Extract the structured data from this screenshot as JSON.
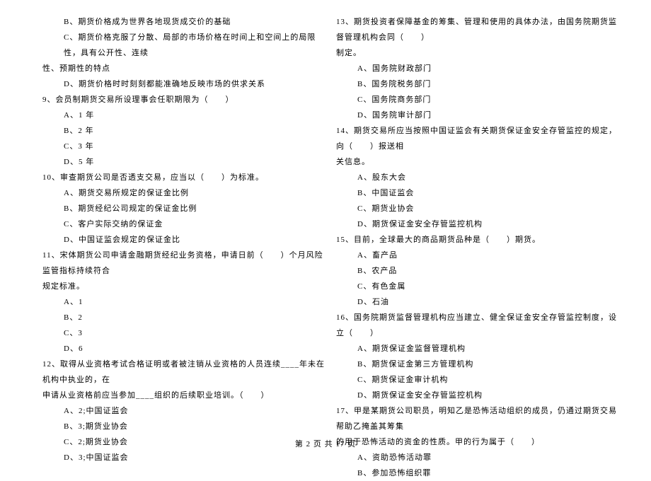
{
  "left_column": {
    "lines": [
      {
        "type": "option",
        "text": "B、期货价格成为世界各地现货成交价的基础"
      },
      {
        "type": "option",
        "text": "C、期货价格克服了分散、局部的市场价格在时间上和空间上的局限性，具有公开性、连续"
      },
      {
        "type": "continuation",
        "text": "性、预期性的特点"
      },
      {
        "type": "option",
        "text": "D、期货价格时时刻刻都能准确地反映市场的供求关系"
      },
      {
        "type": "question",
        "text": "9、会员制期货交易所设理事会任职期限为（　　）"
      },
      {
        "type": "option",
        "text": "A、1 年"
      },
      {
        "type": "option",
        "text": "B、2 年"
      },
      {
        "type": "option",
        "text": "C、3 年"
      },
      {
        "type": "option",
        "text": "D、5 年"
      },
      {
        "type": "question",
        "text": "10、审查期货公司是否透支交易，应当以（　　）为标准。"
      },
      {
        "type": "option",
        "text": "A、期货交易所规定的保证金比例"
      },
      {
        "type": "option",
        "text": "B、期货经纪公司规定的保证金比例"
      },
      {
        "type": "option",
        "text": "C、客户实际交纳的保证金"
      },
      {
        "type": "option",
        "text": "D、中国证监会规定的保证金比"
      },
      {
        "type": "question",
        "text": "11、宋体期货公司申请金融期货经纪业务资格，申请日前（　　）个月风险监管指标持续符合"
      },
      {
        "type": "continuation",
        "text": "规定标准。"
      },
      {
        "type": "option",
        "text": "A、1"
      },
      {
        "type": "option",
        "text": "B、2"
      },
      {
        "type": "option",
        "text": "C、3"
      },
      {
        "type": "option",
        "text": "D、6"
      },
      {
        "type": "question",
        "text": "12、取得从业资格考试合格证明或者被注销从业资格的人员连续____年未在机构中执业的，在"
      },
      {
        "type": "continuation",
        "text": "申请从业资格前应当参加____组织的后续职业培训。（　　）"
      },
      {
        "type": "option",
        "text": "A、2;中国证监会"
      },
      {
        "type": "option",
        "text": "B、3;期货业协会"
      },
      {
        "type": "option",
        "text": "C、2;期货业协会"
      },
      {
        "type": "option",
        "text": "D、3;中国证监会"
      }
    ]
  },
  "right_column": {
    "lines": [
      {
        "type": "question",
        "text": "13、期货投资者保障基金的筹集、管理和使用的具体办法，由国务院期货监督管理机构会同（　　）"
      },
      {
        "type": "continuation",
        "text": "制定。"
      },
      {
        "type": "option",
        "text": "A、国务院财政部门"
      },
      {
        "type": "option",
        "text": "B、国务院税务部门"
      },
      {
        "type": "option",
        "text": "C、国务院商务部门"
      },
      {
        "type": "option",
        "text": "D、国务院审计部门"
      },
      {
        "type": "question",
        "text": "14、期货交易所应当按照中国证监会有关期货保证金安全存管监控的规定，向（　　）报送相"
      },
      {
        "type": "continuation",
        "text": "关信息。"
      },
      {
        "type": "option",
        "text": "A、股东大会"
      },
      {
        "type": "option",
        "text": "B、中国证监会"
      },
      {
        "type": "option",
        "text": "C、期货业协会"
      },
      {
        "type": "option",
        "text": "D、期货保证金安全存管监控机构"
      },
      {
        "type": "question",
        "text": "15、目前，全球最大的商品期货品种是（　　）期货。"
      },
      {
        "type": "option",
        "text": "A、畜产品"
      },
      {
        "type": "option",
        "text": "B、农产品"
      },
      {
        "type": "option",
        "text": "C、有色金属"
      },
      {
        "type": "option",
        "text": "D、石油"
      },
      {
        "type": "question",
        "text": "16、国务院期货监督管理机构应当建立、健全保证金安全存管监控制度，设立（　　）"
      },
      {
        "type": "option",
        "text": "A、期货保证金监督管理机构"
      },
      {
        "type": "option",
        "text": "B、期货保证金第三方管理机构"
      },
      {
        "type": "option",
        "text": "C、期货保证金审计机构"
      },
      {
        "type": "option",
        "text": "D、期货保证金安全存管监控机构"
      },
      {
        "type": "question",
        "text": "17、甲是某期货公司职员，明知乙是恐怖活动组织的成员，仍通过期货交易帮助乙掩盖其筹集"
      },
      {
        "type": "continuation",
        "text": "的用于恐怖活动的资金的性质。甲的行为属于（　　）"
      },
      {
        "type": "option",
        "text": "A、资助恐怖活动罪"
      },
      {
        "type": "option",
        "text": "B、参加恐怖组织罪"
      }
    ]
  },
  "footer": "第 2 页 共 17 页"
}
